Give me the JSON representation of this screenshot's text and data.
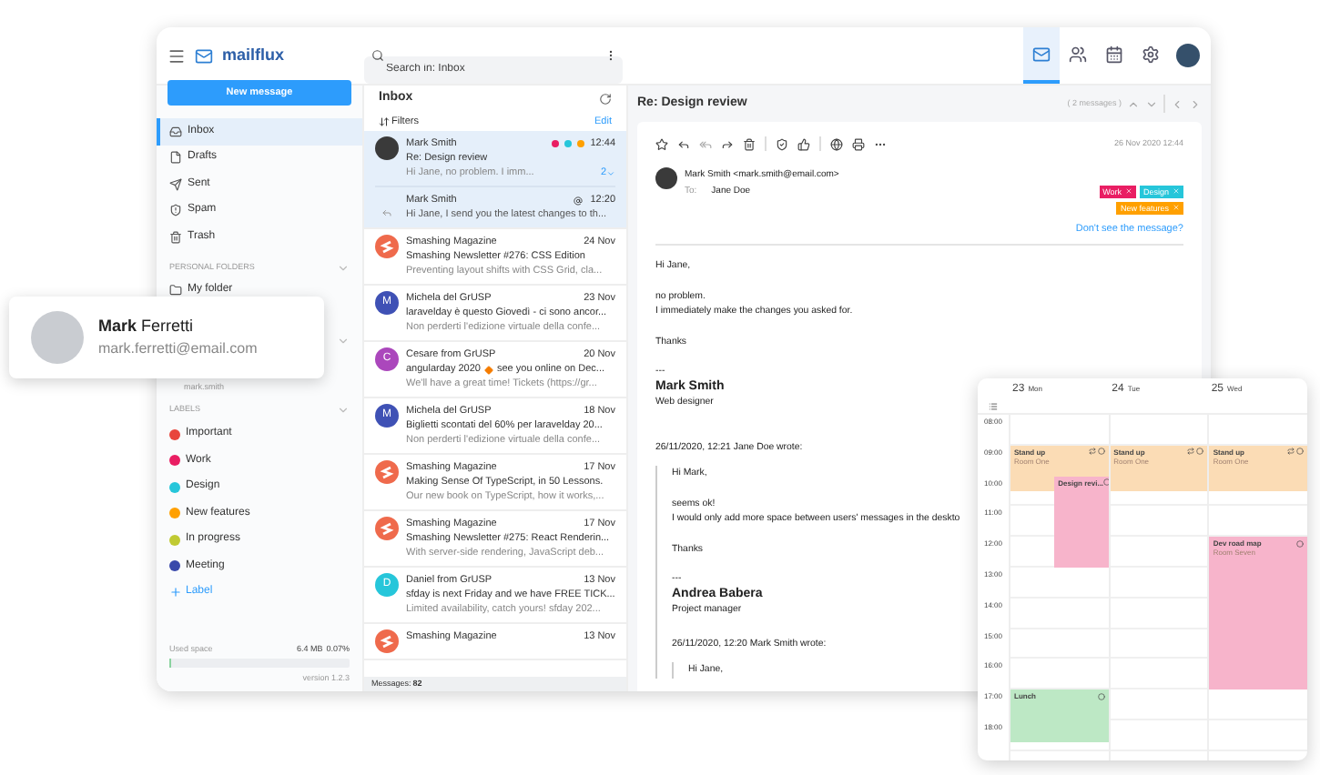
{
  "topbar": {
    "brand": "mailflux",
    "search_placeholder": "Search in: Inbox",
    "nav": [
      {
        "selected": true
      },
      {
        "selected": false
      },
      {
        "selected": false
      },
      {
        "selected": false
      }
    ]
  },
  "sidebar": {
    "new_message": "New message",
    "folders": [
      {
        "label": "Inbox",
        "selected": true
      },
      {
        "label": "Drafts",
        "selected": false
      },
      {
        "label": "Sent",
        "selected": false
      },
      {
        "label": "Spam",
        "selected": false
      },
      {
        "label": "Trash",
        "selected": false
      }
    ],
    "personal_heading": "PERSONAL FOLDERS",
    "personal": [
      {
        "label": "My folder"
      }
    ],
    "account_caption": "mark.smith",
    "labels_heading": "LABELS",
    "labels": [
      {
        "label": "Important",
        "color": "#e8453c"
      },
      {
        "label": "Work",
        "color": "#e91e63"
      },
      {
        "label": "Design",
        "color": "#26c6da"
      },
      {
        "label": "New features",
        "color": "#ffa000"
      },
      {
        "label": "In progress",
        "color": "#c0ca33"
      },
      {
        "label": "Meeting",
        "color": "#3949ab"
      }
    ],
    "add_label": "Label",
    "used_space": "Used space",
    "used_value": "6.4 MB",
    "used_percent": "0.07%",
    "level": 0.01,
    "version": "version 1.2.3"
  },
  "list": {
    "title": "Inbox",
    "filters": "Filters",
    "edit": "Edit",
    "footer_label": "Messages:",
    "footer_count": "82",
    "messages": [
      {
        "kind": "photo",
        "sender": "Mark Smith",
        "time": "12:44",
        "subject": "Re: Design review",
        "preview": "Hi Jane, no problem. I imm...",
        "selected": true,
        "dots": [
          {
            "color": "#e91e63"
          },
          {
            "color": "#26c6da"
          },
          {
            "color": "#ffa000"
          }
        ],
        "count": "2",
        "reply": {
          "sender": "Mark Smith",
          "time": "12:20",
          "preview": "Hi Jane, I send you the latest changes to th..."
        }
      },
      {
        "kind": "logo",
        "color": "#ef6a4c",
        "sender": "Smashing Magazine",
        "time": "24 Nov",
        "subject": "Smashing Newsletter #276: CSS Edition",
        "preview": "Preventing layout shifts with CSS Grid, cla...",
        "selected": false
      },
      {
        "kind": "letter",
        "letter": "M",
        "color": "#3f51b5",
        "sender": "Michela del GrUSP",
        "time": "23 Nov",
        "subject": "laravelday è questo Giovedì - ci sono ancor...",
        "preview": "Non perderti l'edizione virtuale della confe...",
        "selected": false
      },
      {
        "kind": "letter",
        "letter": "C",
        "color": "#ab47bc",
        "sender": "Cesare from GrUSP",
        "time": "20 Nov",
        "subject": "angularday 2020",
        "subject_after": "see you online on Dec...",
        "preview": "We'll have a great time!  Tickets (https://gr...",
        "selected": false
      },
      {
        "kind": "letter",
        "letter": "M",
        "color": "#3f51b5",
        "sender": "Michela del GrUSP",
        "time": "18 Nov",
        "subject": "Biglietti scontati del 60% per laravelday 20...",
        "preview": "Non perderti l'edizione virtuale della confe...",
        "selected": false
      },
      {
        "kind": "logo",
        "color": "#ef6a4c",
        "sender": "Smashing Magazine",
        "time": "17 Nov",
        "subject": "Making Sense Of TypeScript, in 50 Lessons.",
        "preview": "Our new book on TypeScript, how it works,...",
        "selected": false
      },
      {
        "kind": "logo",
        "color": "#ef6a4c",
        "sender": "Smashing Magazine",
        "time": "17 Nov",
        "subject": "Smashing Newsletter #275: React Renderin...",
        "preview": "With server-side rendering, JavaScript deb...",
        "selected": false
      },
      {
        "kind": "letter",
        "letter": "D",
        "color": "#26c6da",
        "sender": "Daniel from GrUSP",
        "time": "13 Nov",
        "subject": "sfday is next Friday and we have FREE TICK...",
        "preview": "Limited availability, catch yours!  sfday 202...",
        "selected": false
      },
      {
        "kind": "logo",
        "color": "#ef6a4c",
        "sender": "Smashing Magazine",
        "time": "13 Nov",
        "selected": false
      }
    ]
  },
  "reader": {
    "subject": "Re: Design review",
    "count": "( 2 messages )",
    "date": "26 Nov 2020 12:44",
    "from": "Mark Smith <mark.smith@email.com>",
    "to_label": "To:",
    "to": "Jane Doe",
    "tags": [
      {
        "label": "Work",
        "color": "#e91e63"
      },
      {
        "label": "Design",
        "color": "#26c6da"
      },
      {
        "label": "New features",
        "color": "#ffa000"
      }
    ],
    "link": "Don't see the message?",
    "body": {
      "paragraphs": [
        [
          "Hi Jane,"
        ],
        [
          "no problem.",
          "I immediately make the changes you asked for."
        ],
        [
          "Thanks"
        ]
      ],
      "signature": [
        "---",
        "Mark Smith",
        "Web designer"
      ],
      "quote": {
        "header": "26/11/2020, 12:21 Jane Doe wrote:",
        "paragraphs": [
          [
            "Hi Mark,"
          ],
          [
            "seems ok!",
            "I would only add more space between users' messages in the deskto"
          ],
          [
            "Thanks"
          ]
        ],
        "signature": [
          "---",
          "Andrea Babera",
          "Project manager"
        ],
        "quote": {
          "header": "26/11/2020, 12:20 Mark Smith  wrote:",
          "paragraphs": [
            [
              "Hi Jane,"
            ]
          ]
        }
      }
    }
  },
  "profile": {
    "name": "**Mark** Ferretti",
    "email": "mark.ferretti@email.com"
  },
  "calendar": {
    "times": [
      "08:00",
      "09:00",
      "10:00",
      "11:00",
      "12:00",
      "13:00",
      "14:00",
      "15:00",
      "16:00",
      "17:00",
      "18:00"
    ],
    "days": [
      {
        "number": "23",
        "name": "Mon",
        "events": [
          {
            "kind": "standup",
            "title": "Stand up",
            "location": "Room One",
            "color": "#fbdcb5",
            "recurring": true
          },
          {
            "kind": "review",
            "title": "Design revi...",
            "color": "#f7b4cb",
            "recurring": false
          },
          {
            "kind": "lunch",
            "title": "Lunch",
            "color": "#bde8c5",
            "recurring": false
          }
        ]
      },
      {
        "number": "24",
        "name": "Tue",
        "events": [
          {
            "kind": "standup",
            "title": "Stand up",
            "location": "Room One",
            "color": "#fbdcb5",
            "recurring": true
          }
        ]
      },
      {
        "number": "25",
        "name": "Wed",
        "events": [
          {
            "kind": "standup",
            "title": "Stand up",
            "location": "Room One",
            "color": "#fbdcb5",
            "recurring": true
          },
          {
            "kind": "roadmap",
            "title": "Dev road map",
            "location": "Room Seven",
            "color": "#f7b4cb",
            "recurring": false
          }
        ]
      }
    ]
  }
}
